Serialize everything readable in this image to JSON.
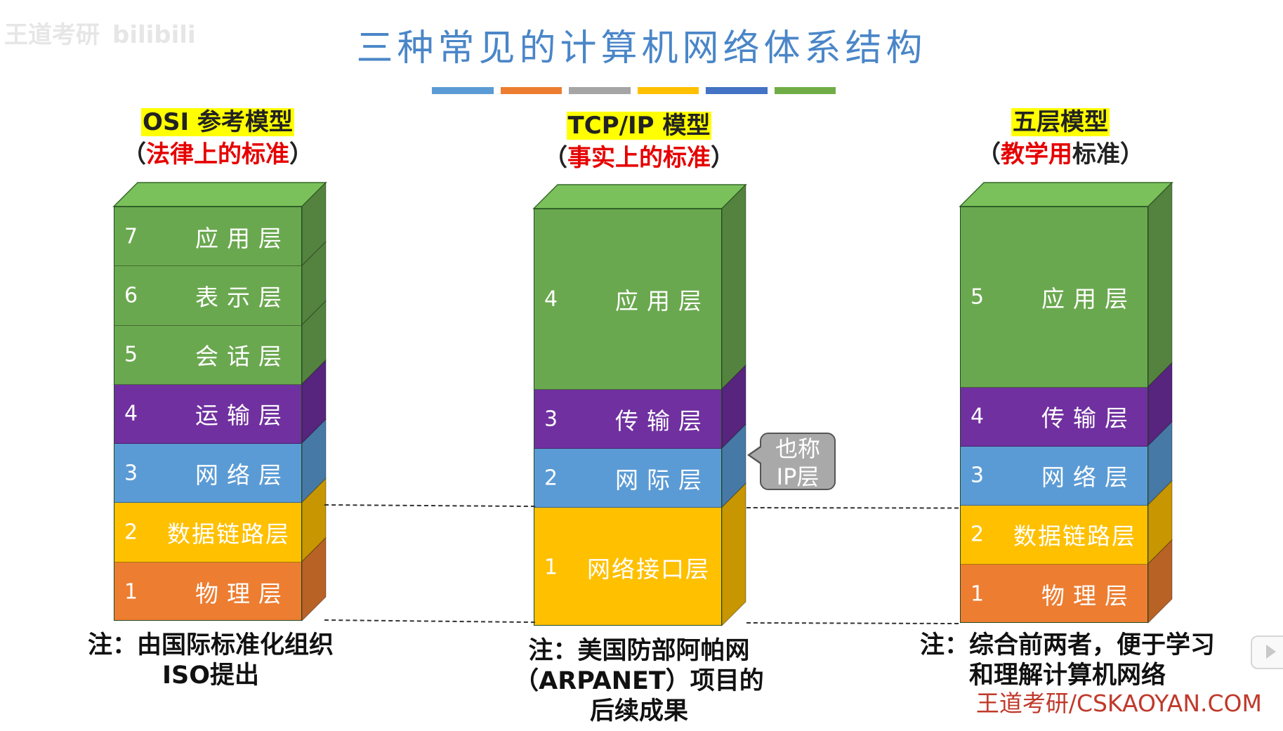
{
  "watermark": {
    "text_1": "王道考研",
    "text_2": "bilibili"
  },
  "title": "三种常见的计算机网络体系结构",
  "stripe_colors": [
    "#5b9bd5",
    "#ed7d31",
    "#a5a5a5",
    "#ffc000",
    "#4472c4",
    "#70ad47"
  ],
  "models": [
    {
      "heading_line1": "OSI 参考模型",
      "heading_line2_prefix": "（",
      "heading_line2_red": "法律上的标准",
      "heading_line2_black": "",
      "heading_line2_suffix": "）",
      "layers": [
        {
          "num": "7",
          "name": "应用层",
          "color": "#6aa84f"
        },
        {
          "num": "6",
          "name": "表示层",
          "color": "#6aa84f"
        },
        {
          "num": "5",
          "name": "会话层",
          "color": "#6aa84f"
        },
        {
          "num": "4",
          "name": "运输层",
          "color": "#7030a0"
        },
        {
          "num": "3",
          "name": "网络层",
          "color": "#5b9bd5"
        },
        {
          "num": "2",
          "name": "数据链路层",
          "color": "#ffc000"
        },
        {
          "num": "1",
          "name": "物理层",
          "color": "#ed7d31"
        }
      ],
      "note_lines": [
        "注：由国际标准化组织",
        "ISO提出"
      ]
    },
    {
      "heading_line1": "TCP/IP 模型",
      "heading_line2_prefix": "（",
      "heading_line2_red": "事实上的标准",
      "heading_line2_black": "",
      "heading_line2_suffix": "）",
      "layers": [
        {
          "num": "4",
          "name": "应用层",
          "color": "#6aa84f"
        },
        {
          "num": "3",
          "name": "传输层",
          "color": "#7030a0"
        },
        {
          "num": "2",
          "name": "网际层",
          "color": "#5b9bd5"
        },
        {
          "num": "1",
          "name": "网络接口层",
          "color": "#ffc000"
        }
      ],
      "note_lines": [
        "注：美国防部阿帕网",
        "（ARPANET）项目的",
        "后续成果"
      ]
    },
    {
      "heading_line1": "五层模型",
      "heading_line2_prefix": "（",
      "heading_line2_red": "教学用",
      "heading_line2_black": "标准",
      "heading_line2_suffix": "）",
      "layers": [
        {
          "num": "5",
          "name": "应用层",
          "color": "#6aa84f"
        },
        {
          "num": "4",
          "name": "传输层",
          "color": "#7030a0"
        },
        {
          "num": "3",
          "name": "网络层",
          "color": "#5b9bd5"
        },
        {
          "num": "2",
          "name": "数据链路层",
          "color": "#ffc000"
        },
        {
          "num": "1",
          "name": "物理层",
          "color": "#ed7d31"
        }
      ],
      "note_lines": [
        "注：综合前两者，便于学习",
        "和理解计算机网络"
      ]
    }
  ],
  "callout": {
    "line1": "也称",
    "line2": "IP层"
  },
  "brand": "王道考研/CSKAOYAN.COM"
}
